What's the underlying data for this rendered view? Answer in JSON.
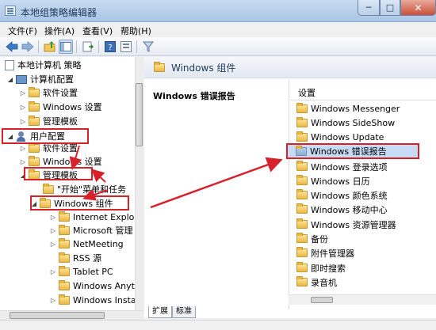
{
  "window": {
    "title": "本地组策略编辑器",
    "min_label": "─",
    "max_label": "□",
    "close_label": "✕"
  },
  "menu": [
    {
      "label": "文件(F)"
    },
    {
      "label": "操作(A)"
    },
    {
      "label": "查看(V)"
    },
    {
      "label": "帮助(H)"
    }
  ],
  "toolbar": {
    "icons": [
      "back-arrow-icon",
      "forward-arrow-icon",
      "folder-up-icon",
      "show-hide-tree-icon",
      "export-list-icon",
      "help-icon",
      "properties-icon",
      "filter-icon"
    ]
  },
  "tree": {
    "root": "本地计算机 策略",
    "computer_config": "计算机配置",
    "software_settings_1": "软件设置",
    "windows_settings_1": "Windows 设置",
    "admin_templates_1": "管理模板",
    "user_config": "用户配置",
    "software_settings_2": "软件设置",
    "windows_settings_2": "Windows 设置",
    "admin_templates_2": "管理模板",
    "start_menu": "\"开始\"菜单和任务",
    "windows_components": "Windows 组件",
    "internet_explorer": "Internet Explor",
    "microsoft_mgmt": "Microsoft 管理",
    "netmeeting": "NetMeeting",
    "rss": "RSS 源",
    "tablet_pc": "Tablet PC",
    "windows_anytime": "Windows Anyti",
    "windows_install": "Windows Insta"
  },
  "detail": {
    "header_title": "Windows 组件",
    "description_title": "Windows 错误报告",
    "list_header": "设置",
    "items": [
      {
        "label": "Windows Messenger"
      },
      {
        "label": "Windows SideShow"
      },
      {
        "label": "Windows Update"
      },
      {
        "label": "Windows 错误报告"
      },
      {
        "label": "Windows 登录选项"
      },
      {
        "label": "Windows 日历"
      },
      {
        "label": "Windows 颜色系统"
      },
      {
        "label": "Windows 移动中心"
      },
      {
        "label": "Windows 资源管理器"
      },
      {
        "label": "备份"
      },
      {
        "label": "附件管理器"
      },
      {
        "label": "即时搜索"
      },
      {
        "label": "录音机"
      }
    ]
  },
  "tabs": [
    {
      "label": "扩展"
    },
    {
      "label": "标准"
    }
  ],
  "colors": {
    "annotation_red": "#d6202a",
    "selection_blue": "#c7dbf5"
  }
}
